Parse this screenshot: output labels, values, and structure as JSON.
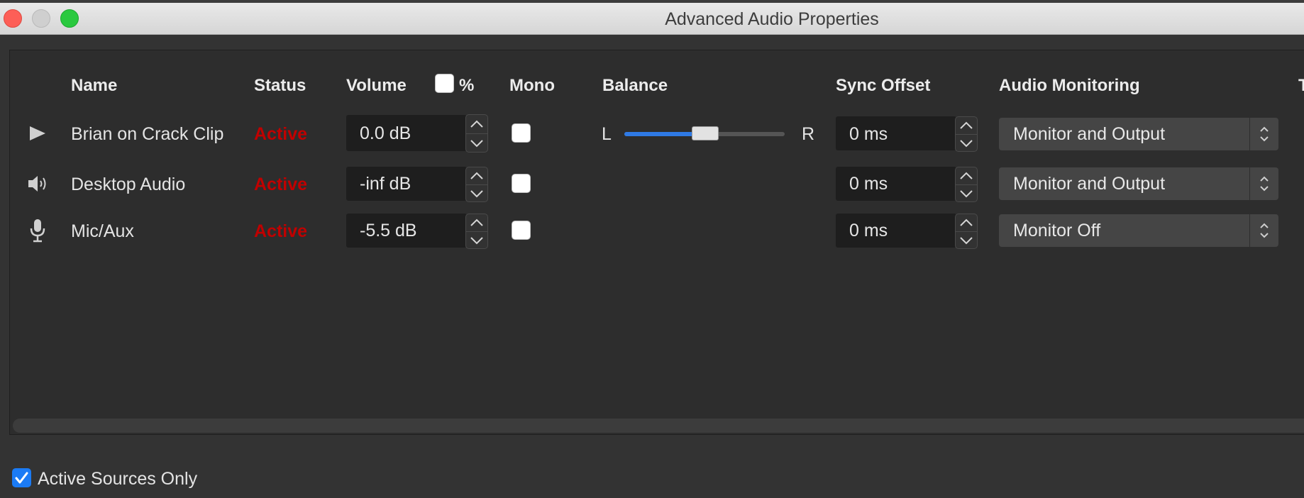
{
  "window": {
    "title": "Advanced Audio Properties"
  },
  "table": {
    "headers": {
      "name": "Name",
      "status": "Status",
      "volume": "Volume",
      "percent": "%",
      "mono": "Mono",
      "balance": "Balance",
      "sync_offset": "Sync Offset",
      "audio_monitoring": "Audio Monitoring",
      "tracks": "T"
    },
    "rows": [
      {
        "icon": "play-icon",
        "name": "Brian on Crack Clip",
        "status": "Active",
        "volume": "0.0 dB",
        "mono": false,
        "balance_left": "L",
        "balance_right": "R",
        "balance_level": 0.5,
        "sync_offset": "0 ms",
        "monitoring": "Monitor and Output"
      },
      {
        "icon": "speaker-icon",
        "name": "Desktop Audio",
        "status": "Active",
        "volume": "-inf dB",
        "mono": false,
        "sync_offset": "0 ms",
        "monitoring": "Monitor and Output"
      },
      {
        "icon": "microphone-icon",
        "name": "Mic/Aux",
        "status": "Active",
        "volume": "-5.5 dB",
        "mono": false,
        "sync_offset": "0 ms",
        "monitoring": "Monitor Off"
      }
    ]
  },
  "footer": {
    "active_sources_only_label": "Active Sources Only",
    "active_sources_only_checked": true
  },
  "colors": {
    "status_active": "#c00000",
    "accent": "#2f7ae5"
  }
}
